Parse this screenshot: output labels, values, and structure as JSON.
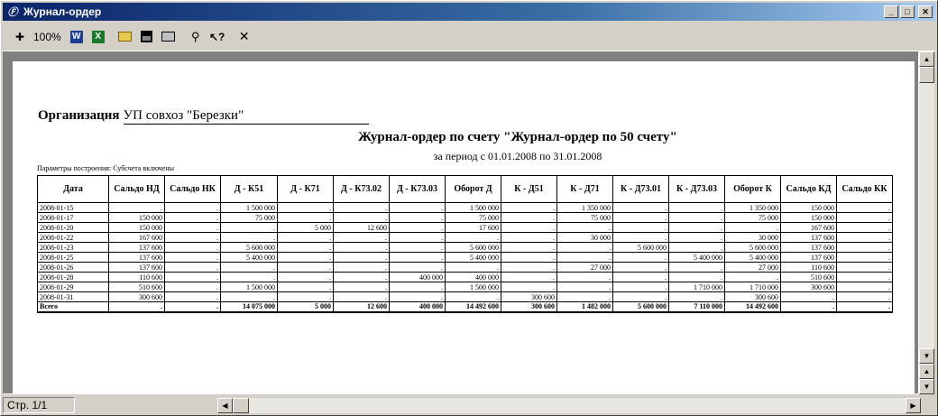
{
  "window": {
    "title": "Журнал-ордер"
  },
  "toolbar": {
    "zoom": "100%"
  },
  "report": {
    "org_label": "Организация",
    "org_value": "УП совхоз \"Березки\"",
    "title": "Журнал-ордер по счету \"Журнал-ордер по 50 счету\"",
    "period": "за период с 01.01.2008 по 31.01.2008",
    "params": "Параметры построения: Субсчета включены"
  },
  "table": {
    "columns": [
      "Дата",
      "Сальдо НД",
      "Сальдо НК",
      "Д - К51",
      "Д - К71",
      "Д - К73.02",
      "Д - К73.03",
      "Оборот Д",
      "К - Д51",
      "К - Д71",
      "К - Д73.01",
      "К - Д73.03",
      "Оборот К",
      "Сальдо КД",
      "Сальдо КК"
    ],
    "rows": [
      [
        "2008-01-15",
        ".",
        ".",
        "1 500 000",
        ".",
        ".",
        ".",
        "1 500 000",
        ".",
        "1 350 000",
        ".",
        ".",
        "1 350 000",
        "150 000",
        "."
      ],
      [
        "2008-01-17",
        "150 000",
        ".",
        "75 000",
        ".",
        ".",
        ".",
        "75 000",
        ".",
        "75 000",
        ".",
        ".",
        "75 000",
        "150 000",
        "."
      ],
      [
        "2008-01-20",
        "150 000",
        ".",
        ".",
        "5 000",
        "12 600",
        ".",
        "17 600",
        ".",
        ".",
        ".",
        ".",
        ".",
        "167 600",
        "."
      ],
      [
        "2008-01-22",
        "167 600",
        ".",
        ".",
        ".",
        ".",
        ".",
        ".",
        ".",
        "30 000",
        ".",
        ".",
        "30 000",
        "137 600",
        "."
      ],
      [
        "2008-01-23",
        "137 600",
        ".",
        "5 600 000",
        ".",
        ".",
        ".",
        "5 600 000",
        ".",
        ".",
        "5 600 000",
        ".",
        "5 600 000",
        "137 600",
        "."
      ],
      [
        "2008-01-25",
        "137 600",
        ".",
        "5 400 000",
        ".",
        ".",
        ".",
        "5 400 000",
        ".",
        ".",
        ".",
        "5 400 000",
        "5 400 000",
        "137 600",
        "."
      ],
      [
        "2008-01-26",
        "137 600",
        ".",
        ".",
        ".",
        ".",
        ".",
        ".",
        ".",
        "27 000",
        ".",
        ".",
        "27 000",
        "110 600",
        "."
      ],
      [
        "2008-01-28",
        "110 600",
        ".",
        ".",
        ".",
        ".",
        "400 000",
        "400 000",
        ".",
        ".",
        ".",
        ".",
        ".",
        "510 600",
        "."
      ],
      [
        "2008-01-29",
        "510 600",
        ".",
        "1 500 000",
        ".",
        ".",
        ".",
        "1 500 000",
        ".",
        ".",
        ".",
        "1 710 000",
        "1 710 000",
        "300 600",
        "."
      ],
      [
        "2008-01-31",
        "300 600",
        ".",
        ".",
        ".",
        ".",
        ".",
        ".",
        "300 600",
        ".",
        ".",
        ".",
        "300 600",
        ".",
        "."
      ],
      [
        "Всего",
        ".",
        ".",
        "14 075 000",
        "5 000",
        "12 600",
        "400 000",
        "14 492 600",
        "300 600",
        "1 482 000",
        "5 600 000",
        "7 110 000",
        "14 492 600",
        ".",
        "."
      ]
    ]
  },
  "status": {
    "page": "Стр. 1/1"
  }
}
